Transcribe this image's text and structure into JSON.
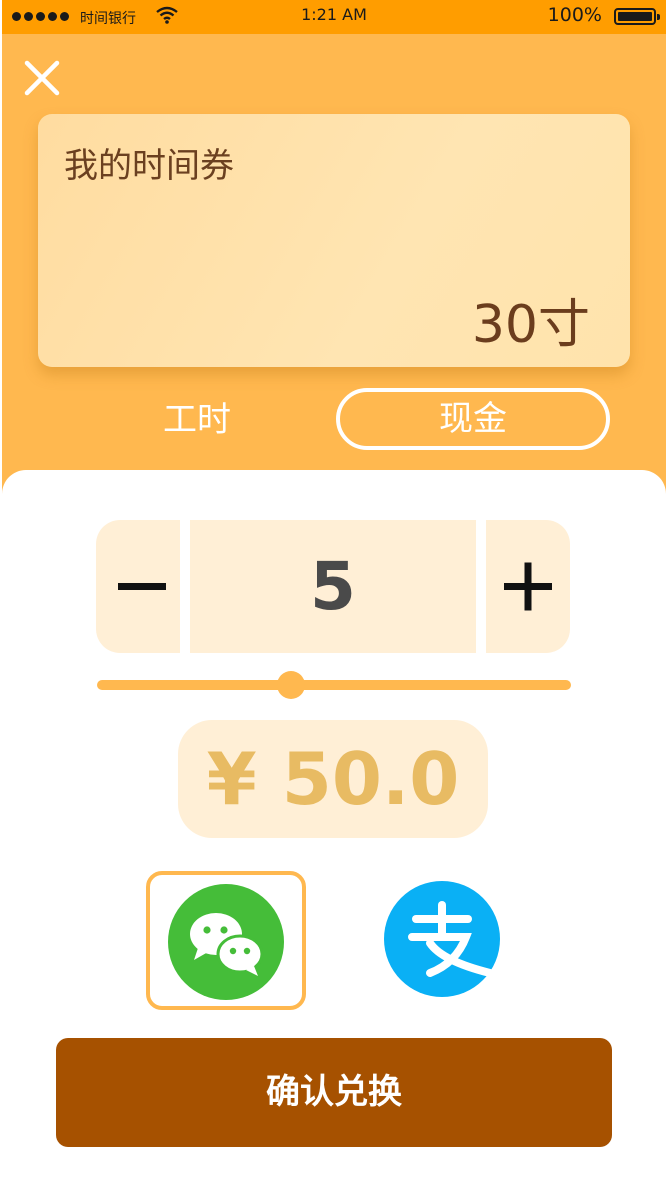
{
  "status_bar": {
    "carrier": "时间银行",
    "time": "1:21 AM",
    "battery": "100%"
  },
  "voucher": {
    "title": "我的时间券",
    "amount": "30寸"
  },
  "tabs": [
    {
      "label": "工时",
      "selected": false
    },
    {
      "label": "现金",
      "selected": true
    }
  ],
  "stepper": {
    "minus": "−",
    "plus": "+",
    "value": "5"
  },
  "slider": {
    "level": 0.41
  },
  "price": "¥ 50.0",
  "payment": [
    {
      "method": "wechat",
      "icon": "wechat-icon",
      "selected": true
    },
    {
      "method": "alipay",
      "icon": "alipay-icon",
      "selected": false
    }
  ],
  "confirm_label": "确认兑换",
  "colors": {
    "accent": "#ffb84f",
    "status_bar": "#ff9d00",
    "confirm": "#a65100",
    "price": "#e8bb63",
    "wechat": "#45bd39",
    "alipay": "#0ab0f5"
  }
}
